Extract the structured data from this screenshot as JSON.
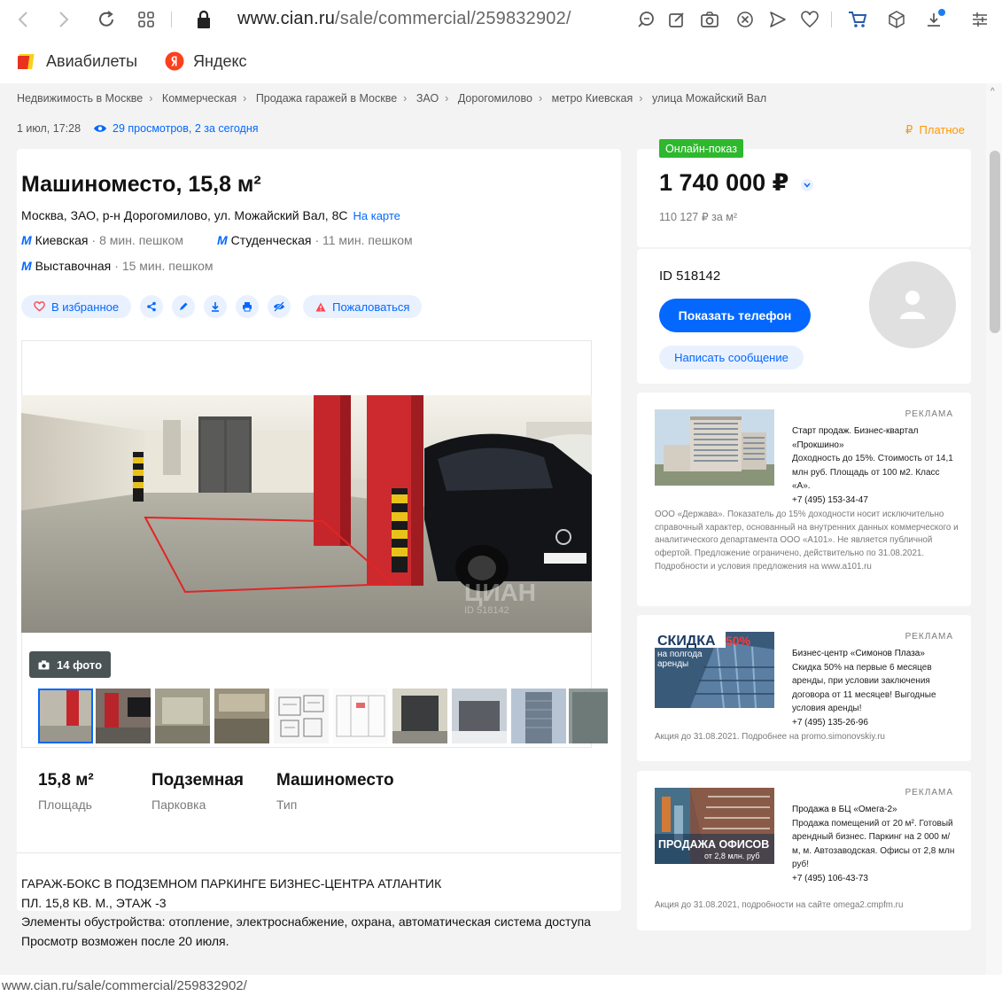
{
  "browser": {
    "url_domain": "www.cian.ru",
    "url_path": "/sale/commercial/259832902/",
    "bookmarks": [
      {
        "label": "Авиабилеты"
      },
      {
        "label": "Яндекс"
      }
    ],
    "status_url": "www.cian.ru/sale/commercial/259832902/"
  },
  "breadcrumbs": [
    "Недвижимость в Москве",
    "Коммерческая",
    "Продажа гаражей в Москве",
    "ЗАО",
    "Дорогомилово",
    "метро Киевская",
    "улица Можайский Вал"
  ],
  "meta": {
    "date": "1 июл, 17:28",
    "views": "29 просмотров, 2 за сегодня",
    "paid": "Платное",
    "paid_symbol": "₽"
  },
  "listing": {
    "title": "Машиноместо, 15,8 м²",
    "address": "Москва, ЗАО, р-н Дорогомилово, ул. Можайский Вал, 8С",
    "map_link": "На карте",
    "metro": [
      {
        "name": "Киевская",
        "time": "· 8 мин. пешком"
      },
      {
        "name": "Студенческая",
        "time": "· 11 мин. пешком"
      },
      {
        "name": "Выставочная",
        "time": "· 15 мин. пешком"
      }
    ],
    "favorite_label": "В избранное",
    "complain_label": "Пожаловаться",
    "photo_count": "14 фото",
    "watermark": "ЦИАН",
    "watermark_id": "ID 518142",
    "stats": [
      {
        "value": "15,8 м²",
        "label": "Площадь"
      },
      {
        "value": "Подземная",
        "label": "Парковка"
      },
      {
        "value": "Машиноместо",
        "label": "Тип"
      }
    ],
    "description": [
      "ГАРАЖ-БОКС В ПОДЗЕМНОМ ПАРКИНГЕ БИЗНЕС-ЦЕНТРА АТЛАНТИК",
      "ПЛ. 15,8 КВ. М., ЭТАЖ -3",
      "Элементы обустройства: отопление, электроснабжение, охрана, автоматическая система доступа",
      "Просмотр возможен после 20 июля."
    ]
  },
  "price_card": {
    "badge": "Онлайн-показ",
    "price": "1 740 000 ₽",
    "price_per_m2": "110 127 ₽ за м²"
  },
  "agent_card": {
    "id": "ID 518142",
    "show_phone": "Показать телефон",
    "write_message": "Написать сообщение"
  },
  "ads": [
    {
      "tag": "РЕКЛАМА",
      "title": "Старт продаж. Бизнес-квартал «Прокшино»",
      "body": "Доходность до 15%. Стоимость от 14,1 млн руб. Площадь от 100 м2. Класс «А».",
      "phone": "+7 (495) 153-34-47",
      "footer": "ООО «Держава». Показатель до 15% доходности носит исключительно справочный характер, основанный на внутренних данных коммерческого и аналитического департамента ООО «А101». Не является публичной офертой. Предложение ограничено, действительно по 31.08.2021. Подробности и условия предложения на www.a101.ru"
    },
    {
      "tag": "РЕКЛАМА",
      "img_title": "СКИДКА",
      "img_pct": "50%",
      "img_sub1": "на полгода",
      "img_sub2": "аренды",
      "title": "Бизнес-центр «Симонов Плаза»",
      "body": "Скидка 50% на первые 6 месяцев аренды, при условии заключения договора от 11 месяцев! Выгодные условия аренды!",
      "phone": "+7 (495) 135-26-96",
      "footer": "Акция до 31.08.2021. Подробнее на promo.simonovskiy.ru"
    },
    {
      "tag": "РЕКЛАМА",
      "img_title": "ПРОДАЖА ОФИСОВ",
      "img_sub": "от 2,8 млн. руб",
      "title": "Продажа в БЦ «Омега-2»",
      "body": "Продажа помещений от 20 м². Готовый арендный бизнес. Паркинг на 2 000 м/м, м. Автозаводская. Офисы от 2,8 млн руб!",
      "phone": "+7 (495) 106-43-73",
      "footer": "Акция до 31.08.2021, подробности на сайте omega2.cmpfm.ru"
    }
  ]
}
